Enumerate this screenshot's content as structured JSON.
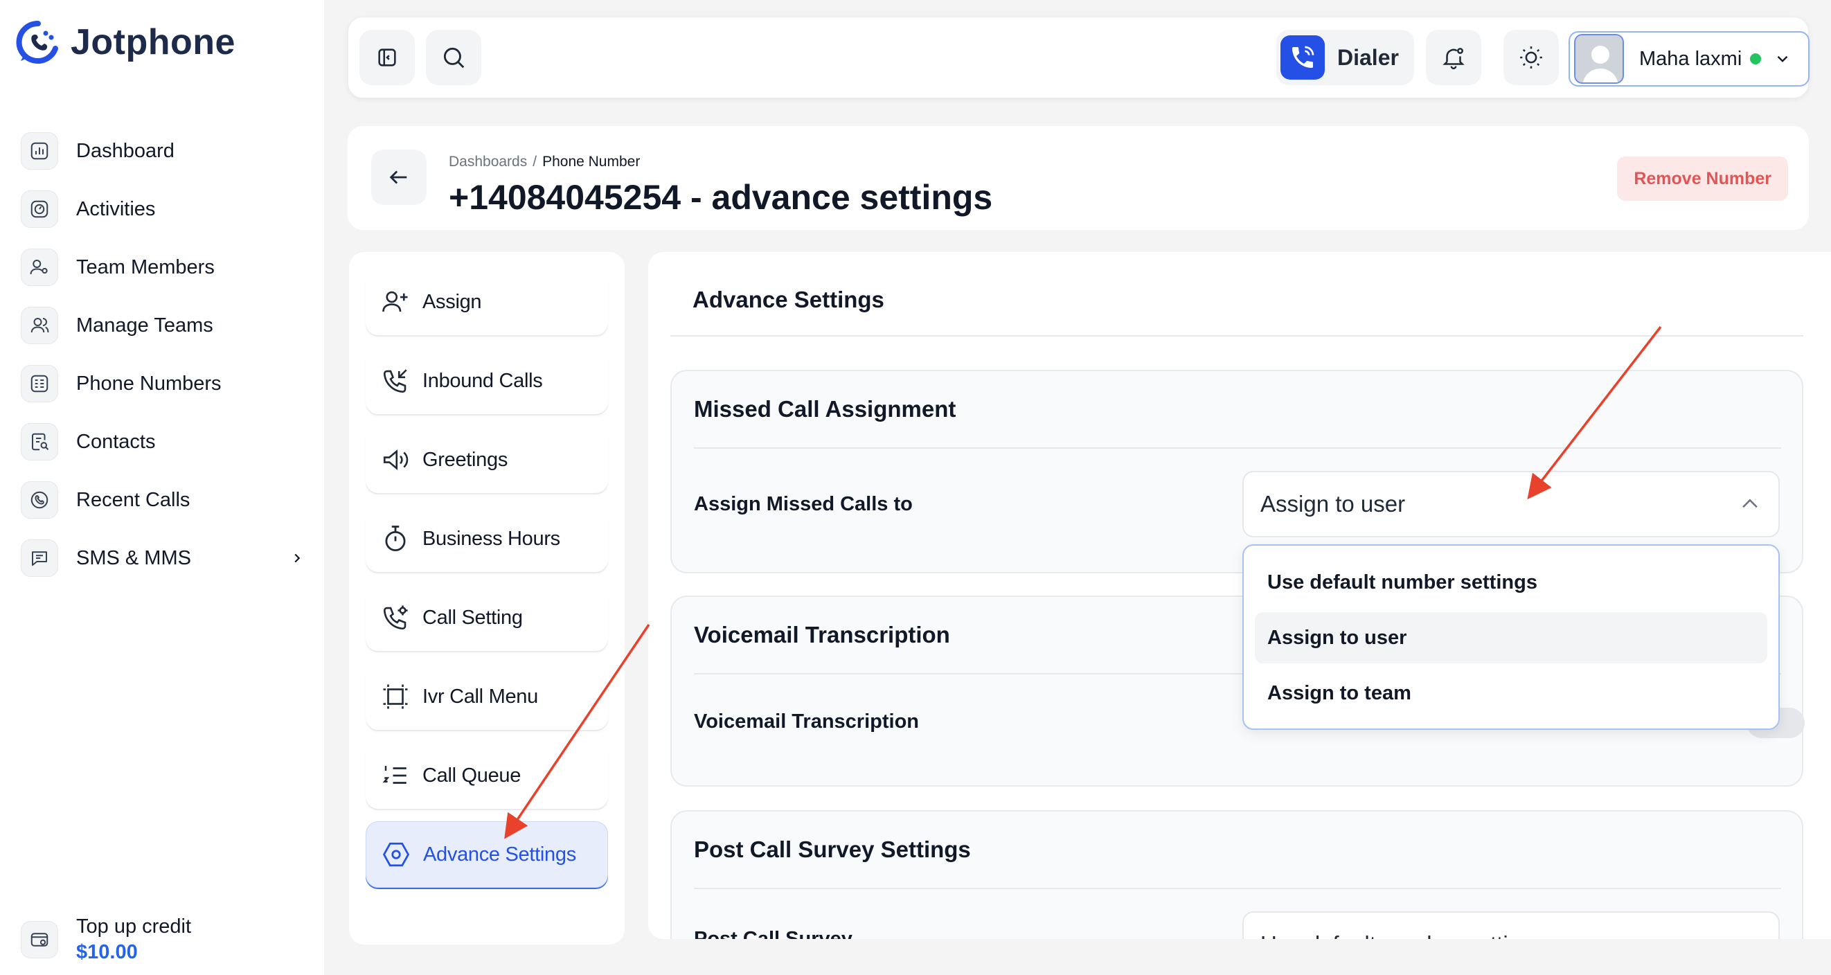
{
  "app": {
    "name": "Jotphone"
  },
  "sidebar": {
    "items": [
      {
        "label": "Dashboard",
        "icon": "chart-icon"
      },
      {
        "label": "Activities",
        "icon": "activity-icon"
      },
      {
        "label": "Team Members",
        "icon": "user-settings-icon"
      },
      {
        "label": "Manage Teams",
        "icon": "users-icon"
      },
      {
        "label": "Phone Numbers",
        "icon": "phone-list-icon"
      },
      {
        "label": "Contacts",
        "icon": "contacts-icon"
      },
      {
        "label": "Recent Calls",
        "icon": "phone-clock-icon"
      },
      {
        "label": "SMS & MMS",
        "icon": "message-icon"
      }
    ],
    "topup": {
      "label": "Top up credit",
      "amount": "$10.00"
    }
  },
  "topbar": {
    "dialer_label": "Dialer",
    "user_name": "Maha laxmi",
    "user_status": "online"
  },
  "header": {
    "breadcrumb": [
      "Dashboards",
      "Phone Number"
    ],
    "breadcrumb_separator": "/",
    "title": "+14084045254 - advance settings",
    "remove_label": "Remove Number"
  },
  "submenu": {
    "items": [
      {
        "label": "Assign",
        "icon": "user-plus-icon"
      },
      {
        "label": "Inbound Calls",
        "icon": "phone-incoming-icon"
      },
      {
        "label": "Greetings",
        "icon": "megaphone-icon"
      },
      {
        "label": "Business Hours",
        "icon": "stopwatch-icon"
      },
      {
        "label": "Call Setting",
        "icon": "phone-gear-icon"
      },
      {
        "label": "Ivr Call Menu",
        "icon": "ivr-frame-icon"
      },
      {
        "label": "Call Queue",
        "icon": "numbered-list-icon"
      },
      {
        "label": "Advance Settings",
        "icon": "hexagon-settings-icon",
        "active": true
      }
    ]
  },
  "main": {
    "title": "Advance Settings",
    "sections": {
      "missed": {
        "title": "Missed Call Assignment",
        "field_label": "Assign Missed Calls to",
        "value": "Assign to user",
        "options": [
          "Use default number settings",
          "Assign to user",
          "Assign to team"
        ],
        "selected_option": "Assign to user"
      },
      "voicemail": {
        "title": "Voicemail Transcription",
        "field_label": "Voicemail Transcription"
      },
      "postcall": {
        "title": "Post Call Survey Settings",
        "field_label": "Post Call Survey",
        "value": "Use default number settings"
      }
    }
  },
  "colors": {
    "accent": "#2450e6",
    "danger": "#e25555",
    "annotation": "#e8412c",
    "online": "#22c55e"
  }
}
